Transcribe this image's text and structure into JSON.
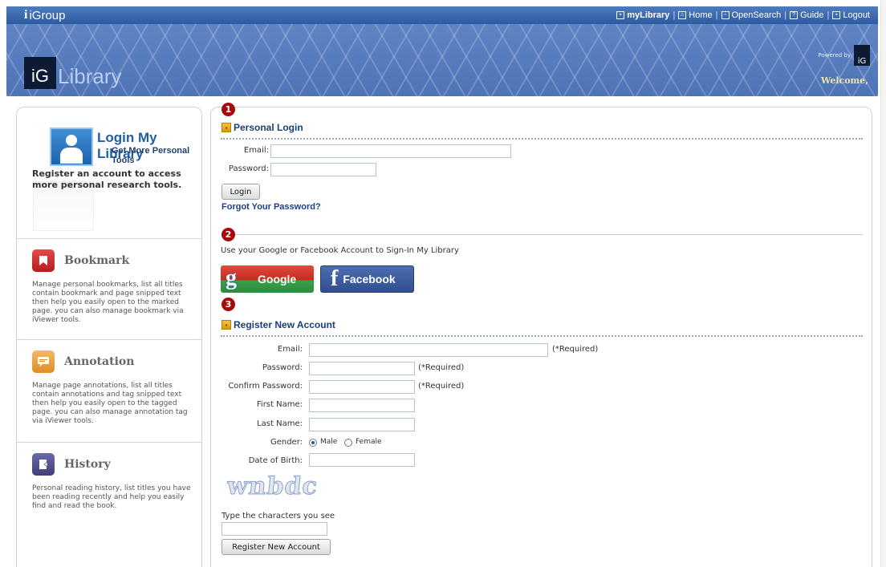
{
  "header": {
    "brand": "iGroup",
    "nav": [
      {
        "label": "myLibrary",
        "icon": "library-icon"
      },
      {
        "label": "Home",
        "icon": "home-icon"
      },
      {
        "label": "OpenSearch",
        "icon": "search-icon"
      },
      {
        "label": "Guide",
        "icon": "help-icon"
      },
      {
        "label": "Logout",
        "icon": "logout-icon"
      }
    ]
  },
  "banner": {
    "logo_mark": "iG",
    "logo_text": "Library",
    "powered_by": "Powered by",
    "powered_mark": "iG",
    "welcome": "Welcome,"
  },
  "sidebar": {
    "promo_title": "Login My Library",
    "promo_subtitle": "Get More Personal Tools",
    "promo_desc": "Register an account to access more personal research tools.",
    "features": [
      {
        "title": "Bookmark",
        "desc": "Manage personal bookmarks, list all titles contain bookmark and page snipped text then help you easily open to the marked page. you can also manage bookmark via iViewer tools."
      },
      {
        "title": "Annotation",
        "desc": "Manage page annotations, list all titles contain annotations and tag snipped text then help you easily open to the tagged page. you can also manage annotation tag via iViewer tools."
      },
      {
        "title": "History",
        "desc": "Personal reading history, list titles you have been reading recently and help you easily find and read the book."
      }
    ]
  },
  "login": {
    "badge": "1",
    "section_title": "Personal Login",
    "email_label": "Email:",
    "email_value": "",
    "password_label": "Password:",
    "password_value": "",
    "login_button": "Login",
    "forgot_link": "Forgot Your Password?"
  },
  "social": {
    "badge": "2",
    "intro": "Use your Google or Facebook Account to Sign-In My Library",
    "google_label": "Google",
    "facebook_label": "Facebook"
  },
  "register": {
    "badge": "3",
    "section_title": "Register New Account",
    "email_label": "Email:",
    "password_label": "Password:",
    "confirm_label": "Confirm Password:",
    "first_name_label": "First Name:",
    "last_name_label": "Last Name:",
    "gender_label": "Gender:",
    "gender_options": [
      "Male",
      "Female"
    ],
    "gender_selected": "Male",
    "dob_label": "Date of Birth:",
    "required_note": "(*Required)",
    "captcha_text": "wnbdc",
    "captcha_prompt": "Type the characters you see",
    "captcha_value": "",
    "register_button": "Register New Account"
  },
  "colors": {
    "header_blue": "#2d5aa0",
    "badge_red": "#a80a0a",
    "link_blue": "#1a3f8a"
  }
}
